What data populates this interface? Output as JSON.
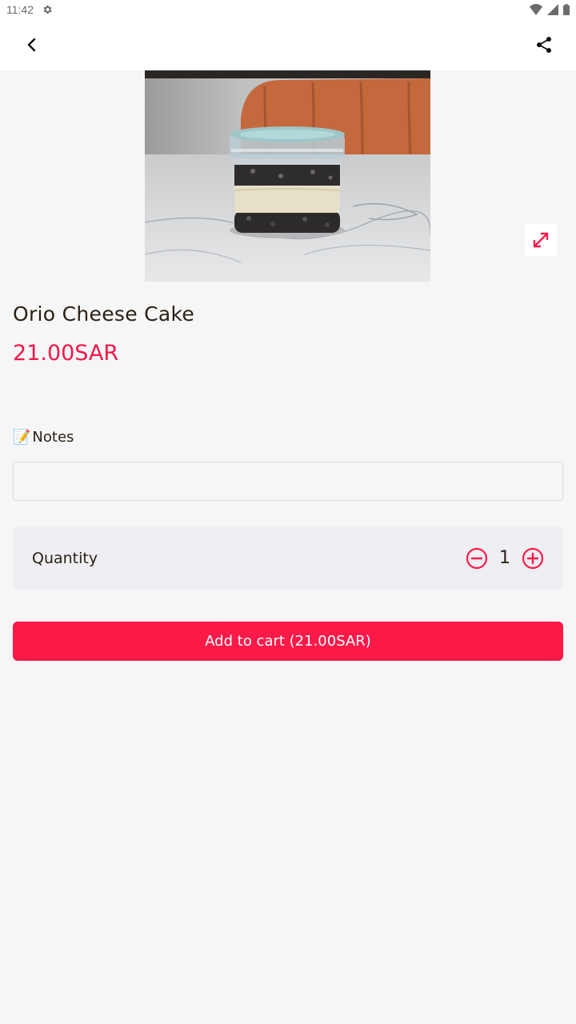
{
  "status_bar": {
    "time": "11:42"
  },
  "product": {
    "title": "Orio Cheese Cake",
    "price": "21.00SAR"
  },
  "notes": {
    "label": "Notes",
    "emoji": "📝",
    "value": "",
    "placeholder": ""
  },
  "quantity": {
    "label": "Quantity",
    "value": "1"
  },
  "cart_button": {
    "label": "Add to cart (21.00SAR)"
  },
  "colors": {
    "accent": "#fd1a49",
    "price": "#f0184a",
    "background": "#f6f6f6",
    "card": "#efeef3"
  }
}
